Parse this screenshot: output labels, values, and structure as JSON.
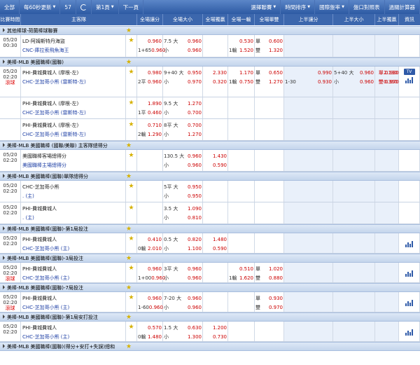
{
  "toolbar": {
    "all": "全部",
    "refresh_interval": "每60秒更新",
    "count": "57",
    "page": "第1頁",
    "next": "下一頁",
    "select_league": "選擇聯賽",
    "time_sort": "時間排序",
    "odds_type": "國際盤率",
    "port_compare": "盤口對照表",
    "parlay_calc": "過關計算器"
  },
  "headers": [
    "比賽時間",
    "主客隊",
    "全場讓分",
    "全場大小",
    "全場獨贏",
    "全場一輸",
    "全場單雙",
    "上半讓分",
    "上半大小",
    "上半獨贏",
    "上半單雙",
    "資訊"
  ],
  "sections": [
    {
      "league": "其他棒球-荷蘭棒球聯賽",
      "rows": [
        {
          "time": "05/20",
          "clock": "00:30",
          "live": "",
          "team1": "LD-阿姆斯特丹海盜",
          "team2": "CNC-庫拉索飛魚海王",
          "hc1": "",
          "hv1": "0.960",
          "hc2": "1+65",
          "hv2": "0.960",
          "ouk1": "7.5 大",
          "ouv1": "0.960",
          "ouk2": "小",
          "ouv2": "0.960",
          "ml1": "",
          "ml2": "",
          "od1": "",
          "odv1": "0.530",
          "od2": "1輸",
          "odv2": "1.520",
          "oe1": "單",
          "oev1": "0.600",
          "oe2": "雙",
          "oev2": "1.320",
          "hhk1": "",
          "hhv1": "",
          "hhk2": "",
          "hhv2": "",
          "houk1": "",
          "houv1": "",
          "houk2": "",
          "houv2": "",
          "hml1": "",
          "hml2": "",
          "ho1": "",
          "ho2": "",
          "tv": false,
          "chart": false
        }
      ]
    },
    {
      "league": "美棒-MLB 美國職棒(國聯)",
      "rows": [
        {
          "time": "05/20",
          "clock": "02:20",
          "live": "滾球",
          "team1": "PHI-費城費城人 (摩根-左)",
          "team2": "CHC-芝加哥小熊 (雷斯特-左)",
          "hc1": "",
          "hv1": "0.980",
          "hc2": "2平",
          "hv2": "0.960",
          "ouk1": "9+40 大",
          "ouv1": "0.950",
          "ouk2": "小",
          "ouv2": "0.970",
          "ml1": "2.330",
          "ml2": "0.320",
          "od1": "",
          "odv1": "1.170",
          "od2": "1輸",
          "odv2": "0.750",
          "oe1": "單",
          "oev1": "0.650",
          "oe2": "雙",
          "oev2": "1.270",
          "hhk1": "",
          "hhv1": "0.990",
          "hhk2": "1-30",
          "hhv2": "0.930",
          "houk1": "5+40 大",
          "houv1": "0.960",
          "houk2": "小",
          "houv2": "0.960",
          "hml1": "2.130",
          "hml2": "0.360",
          "ho1": "單 0.930",
          "ho2": "雙 0.970",
          "tv": true,
          "chart": true
        },
        {
          "time": "",
          "clock": "",
          "live": "",
          "team1": "PHI-費城費城人 (摩根-左)",
          "team2": "CHC-芝加哥小熊 (雷斯特-左)",
          "hc1": "",
          "hv1": "1.890",
          "hc2": "1平",
          "hv2": "0.460",
          "ouk1": "9.5 大",
          "ouv1": "1.270",
          "ouk2": "小",
          "ouv2": "0.700",
          "ml1": "",
          "ml2": "",
          "od1": "",
          "odv1": "",
          "od2": "",
          "odv2": "",
          "oe1": "",
          "oev1": "",
          "oe2": "",
          "oev2": "",
          "hhk1": "",
          "hhv1": "",
          "hhk2": "",
          "hhv2": "",
          "houk1": "",
          "houv1": "",
          "houk2": "",
          "houv2": "",
          "hml1": "",
          "hml2": "",
          "ho1": "",
          "ho2": "",
          "tv": false,
          "chart": false
        },
        {
          "time": "",
          "clock": "",
          "live": "",
          "team1": "PHI-費城費城人 (摩根-左)",
          "team2": "CHC-芝加哥小熊 (雷斯特-左)",
          "hc1": "",
          "hv1": "0.710",
          "hc2": "2輸",
          "hv2": "1.290",
          "ouk1": "8平 大",
          "ouv1": "0.700",
          "ouk2": "小",
          "ouv2": "1.270",
          "ml1": "",
          "ml2": "",
          "od1": "",
          "odv1": "",
          "od2": "",
          "odv2": "",
          "oe1": "",
          "oev1": "",
          "oe2": "",
          "oev2": "",
          "hhk1": "",
          "hhv1": "",
          "hhk2": "",
          "hhv2": "",
          "houk1": "",
          "houv1": "",
          "houk2": "",
          "houv2": "",
          "hml1": "",
          "hml2": "",
          "ho1": "",
          "ho2": "",
          "tv": false,
          "chart": false
        }
      ]
    },
    {
      "league": "美棒-MLB 美國職棒 (國聯/美聯) 主客隊總得分",
      "rows": [
        {
          "time": "05/20",
          "clock": "02:20",
          "live": "",
          "team1": "美國職棒客場總得分",
          "team2": "美國職棒主場總得分",
          "hc1": "",
          "hv1": "",
          "hc2": "",
          "hv2": "",
          "ouk1": "130.5 大",
          "ouv1": "0.960",
          "ouk2": "小",
          "ouv2": "0.960",
          "ml1": "1.430",
          "ml2": "0.590",
          "od1": "",
          "odv1": "",
          "od2": "",
          "odv2": "",
          "oe1": "",
          "oev1": "",
          "oe2": "",
          "oev2": "",
          "hhk1": "",
          "hhv1": "",
          "hhk2": "",
          "hhv2": "",
          "houk1": "",
          "houv1": "",
          "houk2": "",
          "houv2": "",
          "hml1": "",
          "hml2": "",
          "ho1": "",
          "ho2": "",
          "tv": false,
          "chart": false
        }
      ]
    },
    {
      "league": "美棒-MLB 美國職棒(國聯)單隊總得分",
      "rows": [
        {
          "time": "05/20",
          "clock": "02:20",
          "live": "",
          "team1": "CHC-芝加哥小熊",
          "team2": ". (主)",
          "hc1": "",
          "hv1": "",
          "hc2": "",
          "hv2": "",
          "ouk1": "5平 大",
          "ouv1": "0.950",
          "ouk2": "小",
          "ouv2": "0.950",
          "ml1": "",
          "ml2": "",
          "od1": "",
          "odv1": "",
          "od2": "",
          "odv2": "",
          "oe1": "",
          "oev1": "",
          "oe2": "",
          "oev2": "",
          "hhk1": "",
          "hhv1": "",
          "hhk2": "",
          "hhv2": "",
          "houk1": "",
          "houv1": "",
          "houk2": "",
          "houv2": "",
          "hml1": "",
          "hml2": "",
          "ho1": "",
          "ho2": "",
          "tv": false,
          "chart": false
        },
        {
          "time": "05/20",
          "clock": "02:20",
          "live": "",
          "team1": "PHI-費城費城人",
          "team2": ". (主)",
          "hc1": "",
          "hv1": "",
          "hc2": "",
          "hv2": "",
          "ouk1": "3.5 大",
          "ouv1": "1.090",
          "ouk2": "小",
          "ouv2": "0.810",
          "ml1": "",
          "ml2": "",
          "od1": "",
          "odv1": "",
          "od2": "",
          "odv2": "",
          "oe1": "",
          "oev1": "",
          "oe2": "",
          "oev2": "",
          "hhk1": "",
          "hhv1": "",
          "hhk2": "",
          "hhv2": "",
          "houk1": "",
          "houv1": "",
          "houk2": "",
          "houv2": "",
          "hml1": "",
          "hml2": "",
          "ho1": "",
          "ho2": "",
          "tv": false,
          "chart": false
        }
      ]
    },
    {
      "league": "美棒-MLB 美國職棒(國聯)-第1局投注",
      "rows": [
        {
          "time": "05/20",
          "clock": "02:20",
          "live": "",
          "team1": "PHI-費城費城人",
          "team2": "CHC-芝加哥小熊 (主)",
          "hc1": "",
          "hv1": "0.410",
          "hc2": "0輸",
          "hv2": "2.010",
          "ouk1": "0.5 大",
          "ouv1": "0.820",
          "ouk2": "小",
          "ouv2": "1.100",
          "ml1": "1.480",
          "ml2": "0.590",
          "od1": "",
          "odv1": "",
          "od2": "",
          "odv2": "",
          "oe1": "",
          "oev1": "",
          "oe2": "",
          "oev2": "",
          "hhk1": "",
          "hhv1": "",
          "hhk2": "",
          "hhv2": "",
          "houk1": "",
          "houv1": "",
          "houk2": "",
          "houv2": "",
          "hml1": "",
          "hml2": "",
          "ho1": "",
          "ho2": "",
          "tv": false,
          "chart": true
        }
      ]
    },
    {
      "league": "美棒-MLB 美國職棒(國聯)-3局投注",
      "rows": [
        {
          "time": "05/20",
          "clock": "02:20",
          "live": "滾球",
          "team1": "PHI-費城費城人",
          "team2": "CHC-芝加哥小熊 (主)",
          "hc1": "",
          "hv1": "0.960",
          "hc2": "1+00",
          "hv2": "0.960",
          "ouk1": "3平 大",
          "ouv1": "0.960",
          "ouk2": "小",
          "ouv2": "0.960",
          "ml1": "",
          "ml2": "",
          "od1": "",
          "odv1": "0.510",
          "od2": "1輸",
          "odv2": "1.620",
          "oe1": "單",
          "oev1": "1.020",
          "oe2": "雙",
          "oev2": "0.880",
          "hhk1": "",
          "hhv1": "",
          "hhk2": "",
          "hhv2": "",
          "houk1": "",
          "houv1": "",
          "houk2": "",
          "houv2": "",
          "hml1": "",
          "hml2": "",
          "ho1": "",
          "ho2": "",
          "tv": false,
          "chart": true
        }
      ]
    },
    {
      "league": "美棒-MLB 美國職棒(國聯)-7局投注",
      "rows": [
        {
          "time": "05/20",
          "clock": "02:20",
          "live": "滾球",
          "team1": "PHI-費城費城人",
          "team2": "CHC-芝加哥小熊 (主)",
          "hc1": "",
          "hv1": "0.960",
          "hc2": "1-60",
          "hv2": "0.960",
          "ouk1": "7-20 大",
          "ouv1": "0.960",
          "ouk2": "小",
          "ouv2": "0.960",
          "ml1": "",
          "ml2": "",
          "od1": "",
          "odv1": "",
          "od2": "",
          "odv2": "",
          "oe1": "單",
          "oev1": "0.930",
          "oe2": "雙",
          "oev2": "0.970",
          "hhk1": "",
          "hhv1": "",
          "hhk2": "",
          "hhv2": "",
          "houk1": "",
          "houv1": "",
          "houk2": "",
          "houv2": "",
          "hml1": "",
          "hml2": "",
          "ho1": "",
          "ho2": "",
          "tv": false,
          "chart": true
        }
      ]
    },
    {
      "league": "美棒-MLB 美國職棒(國聯)-第1局安打投注",
      "rows": [
        {
          "time": "05/20",
          "clock": "02:20",
          "live": "",
          "team1": "PHI-費城費城人",
          "team2": "CHC-芝加哥小熊 (主)",
          "hc1": "",
          "hv1": "0.570",
          "hc2": "0輸",
          "hv2": "1.480",
          "ouk1": "1.5 大",
          "ouv1": "0.630",
          "ouk2": "小",
          "ouv2": "1.300",
          "ml1": "1.200",
          "ml2": "0.730",
          "od1": "",
          "odv1": "",
          "od2": "",
          "odv2": "",
          "oe1": "",
          "oev1": "",
          "oe2": "",
          "oev2": "",
          "hhk1": "",
          "hhv1": "",
          "hhk2": "",
          "hhv2": "",
          "houk1": "",
          "houv1": "",
          "houk2": "",
          "houv2": "",
          "hml1": "",
          "hml2": "",
          "ho1": "",
          "ho2": "",
          "tv": false,
          "chart": true
        }
      ]
    },
    {
      "league": "美棒-MLB 美國職棒(國聯)(得分+安打+失誤)總和",
      "rows": []
    }
  ]
}
